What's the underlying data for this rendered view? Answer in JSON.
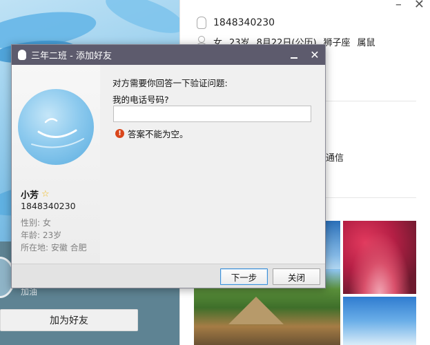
{
  "profile": {
    "qq_number": "1848340230",
    "gender": "女",
    "age": "23岁",
    "birthday": "8月22日(公历)",
    "zodiac": "狮子座",
    "chinese_zodiac": "属鼠",
    "partial_text": "通信",
    "signature": "加油",
    "add_friend_label": "加为好友"
  },
  "dialog": {
    "title": "三年二班 - 添加好友",
    "minimize_label": "",
    "close_glyph": "✕",
    "user": {
      "nickname": "小芳",
      "qq_number": "1848340230",
      "gender": "性别: 女",
      "age": "年龄: 23岁",
      "location": "所在地: 安徽  合肥"
    },
    "prompt": "对方需要你回答一下验证问题:",
    "question": "我的电话号码?",
    "answer_value": "",
    "error_text": "答案不能为空。",
    "error_glyph": "!",
    "next_label": "下一步",
    "close_label": "关闭"
  },
  "colors": {
    "title_bar": "#5d5b6d",
    "error": "#d9461b",
    "star": "#f1b816"
  }
}
